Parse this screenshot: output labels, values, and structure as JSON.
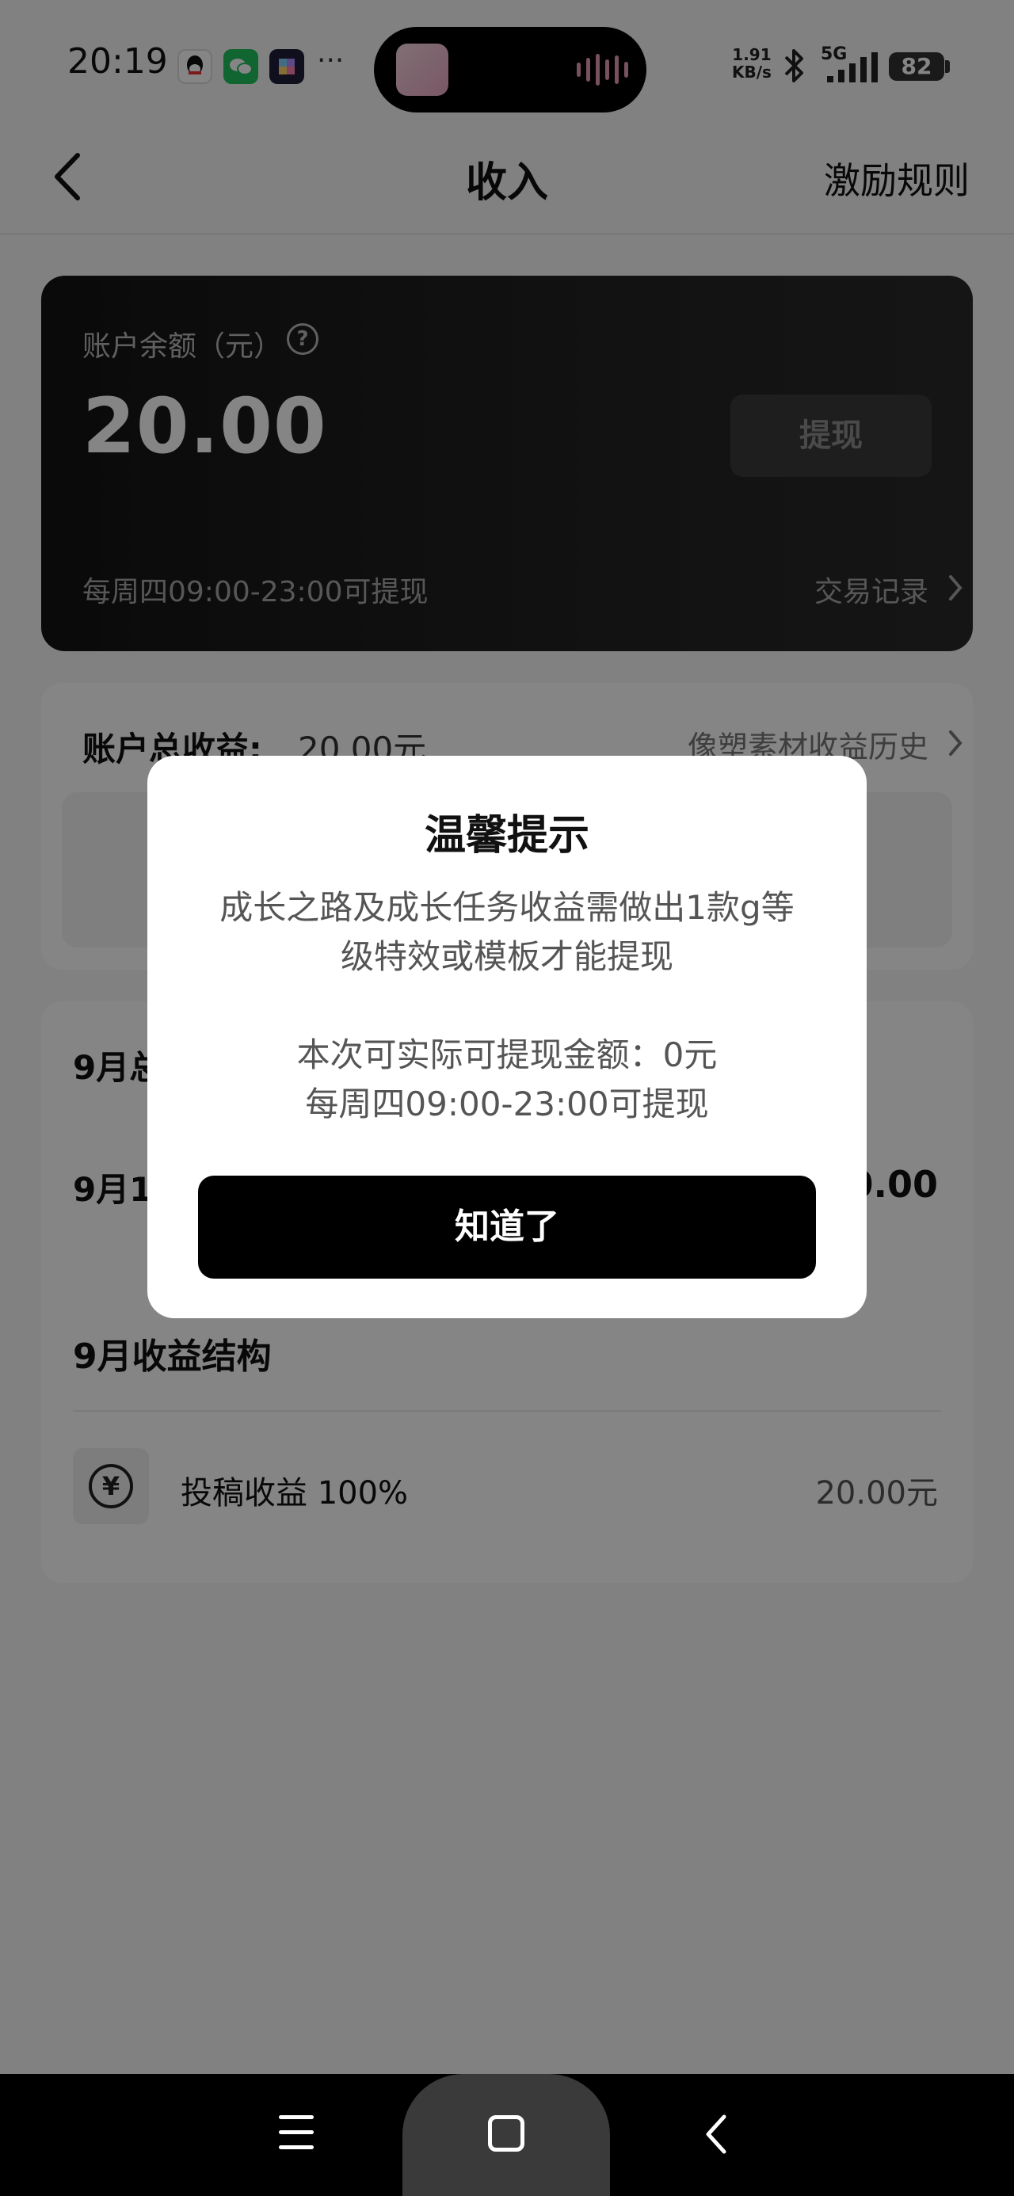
{
  "status_bar": {
    "time": "20:19",
    "more": "···",
    "net_speed_value": "1.91",
    "net_speed_unit": "KB/s",
    "network": "5G",
    "battery": "82",
    "icons": [
      "qq-icon",
      "wechat-icon",
      "app-icon",
      "bluetooth-icon",
      "signal-icon",
      "battery-icon"
    ]
  },
  "header": {
    "title": "收入",
    "right_link": "激励规则"
  },
  "balance": {
    "label": "账户余额（元）",
    "amount": "20.00",
    "withdraw_button": "提现",
    "note": "每周四09:00-23:00可提现",
    "records_link": "交易记录"
  },
  "earnings": {
    "total_label": "账户总收益:",
    "total_value": "20.00元",
    "history_link": "像塑素材收益历史"
  },
  "month": {
    "row1_label": "9月总",
    "row2_label": "9月1",
    "row2_value": "0.00",
    "structure_title": "9月收益结构",
    "items": [
      {
        "label": "投稿收益 100%",
        "value": "20.00元",
        "icon": "yuan-icon"
      }
    ]
  },
  "dialog": {
    "title": "温馨提示",
    "line1": "成长之路及成长任务收益需做出1款g等",
    "line2": "级特效或模板才能提现",
    "line3": "本次可实际可提现金额：0元",
    "line4": "每周四09:00-23:00可提现",
    "button": "知道了"
  },
  "nav": {
    "icons": [
      "menu-icon",
      "home-icon",
      "back-icon"
    ]
  },
  "colors": {
    "card_dark": "#1a1a1a",
    "dialog_button": "#000000",
    "overlay": "rgba(0,0,0,0.48)"
  }
}
